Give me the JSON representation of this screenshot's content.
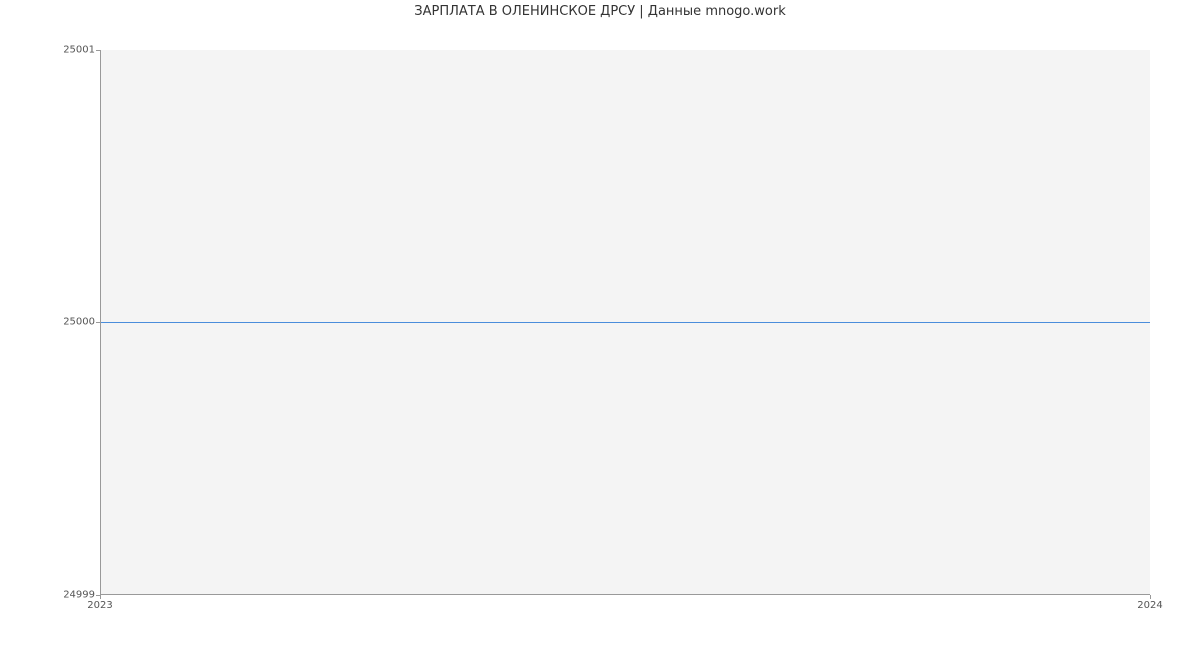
{
  "chart_data": {
    "type": "line",
    "title": "ЗАРПЛАТА В ОЛЕНИНСКОЕ ДРСУ | Данные mnogo.work",
    "xlabel": "",
    "ylabel": "",
    "x": [
      "2023",
      "2024"
    ],
    "values": [
      25000,
      25000
    ],
    "x_ticks": [
      "2023",
      "2024"
    ],
    "y_ticks": [
      "24999",
      "25000",
      "25001"
    ],
    "ylim": [
      24999,
      25001
    ],
    "line_color": "#4a8ddb",
    "grid": false
  }
}
